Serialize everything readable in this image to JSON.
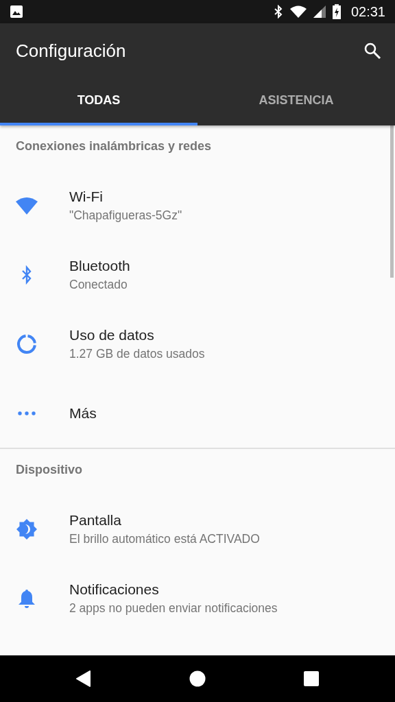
{
  "status_bar": {
    "time": "02:31"
  },
  "toolbar": {
    "title": "Configuración"
  },
  "tabs": [
    {
      "label": "TODAS",
      "selected": true
    },
    {
      "label": "ASISTENCIA",
      "selected": false
    }
  ],
  "sections": [
    {
      "title": "Conexiones inalámbricas y redes",
      "items": [
        {
          "kind": "wifi",
          "title": "Wi-Fi",
          "subtitle": "\"Chapafigueras-5Gz\""
        },
        {
          "kind": "bluetooth",
          "title": "Bluetooth",
          "subtitle": "Conectado"
        },
        {
          "kind": "data",
          "title": "Uso de datos",
          "subtitle": "1.27 GB de datos usados"
        },
        {
          "kind": "more",
          "title": "Más"
        }
      ]
    },
    {
      "title": "Dispositivo",
      "items": [
        {
          "kind": "display",
          "title": "Pantalla",
          "subtitle": "El brillo automático está ACTIVADO"
        },
        {
          "kind": "notifications",
          "title": "Notificaciones",
          "subtitle": "2 apps no pueden enviar notificaciones"
        }
      ]
    }
  ]
}
